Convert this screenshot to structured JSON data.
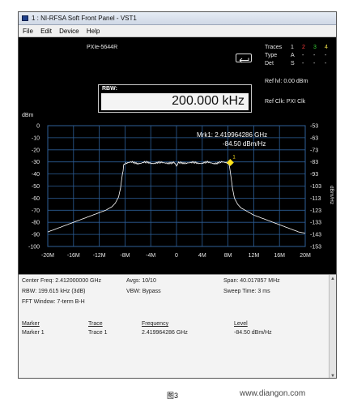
{
  "window": {
    "title": "1 : NI-RFSA Soft Front Panel - VST1",
    "menus": [
      "File",
      "Edit",
      "Device",
      "Help"
    ]
  },
  "header": {
    "device": "PXIe-5644R",
    "traces_label": "Traces",
    "type_label": "Type",
    "det_label": "Det",
    "trace_numbers": [
      "1",
      "2",
      "3",
      "4"
    ],
    "trace_colors": [
      "#ffffff",
      "#ff3b3b",
      "#36d236",
      "#f0e14a"
    ],
    "type_values": [
      "A",
      "-",
      "-",
      "-"
    ],
    "det_values": [
      "S",
      "-",
      "-",
      "-"
    ],
    "ref_lvl": "Ref lvl: 0.00 dBm",
    "ref_clk": "Ref Clk: PXI Clk",
    "rbw_label": "RBW:",
    "rbw_value": "200.000 kHz",
    "return_icon": "return-arrow-icon"
  },
  "chart_data": {
    "type": "line",
    "left_axis_unit": "dBm",
    "right_axis_unit": "dBm/Hz",
    "x_ticks": [
      "-20M",
      "-16M",
      "-12M",
      "-8M",
      "-4M",
      "0",
      "4M",
      "8M",
      "12M",
      "16M",
      "20M"
    ],
    "y_ticks_left": [
      "0",
      "-10",
      "-20",
      "-30",
      "-40",
      "-50",
      "-60",
      "-70",
      "-80",
      "-90",
      "-100"
    ],
    "y_ticks_right": [
      "-53",
      "-63",
      "-73",
      "-83",
      "-93",
      "-103",
      "-113",
      "-123",
      "-133",
      "-143",
      "-153"
    ],
    "xlim": [
      -20,
      20
    ],
    "ylim": [
      -100,
      0
    ],
    "grid": true,
    "series": [
      {
        "color": "#ffffff",
        "x": [
          -20,
          -19,
          -18,
          -17,
          -16,
          -15,
          -14,
          -13,
          -12,
          -11,
          -10,
          -9.5,
          -9,
          -8.7,
          -8.4,
          -8.2,
          -8,
          -7,
          -6,
          -5,
          -4,
          -3,
          -2,
          -1,
          -0.3,
          0,
          0.3,
          1,
          2,
          3,
          4,
          5,
          6,
          7,
          8,
          8.2,
          8.4,
          8.7,
          9,
          9.5,
          10,
          11,
          12,
          13,
          14,
          15,
          16,
          17,
          18,
          19,
          20
        ],
        "y": [
          -88,
          -86,
          -84,
          -82,
          -80,
          -78,
          -76,
          -74,
          -72,
          -70,
          -67,
          -64,
          -59,
          -52,
          -40,
          -33,
          -31,
          -30.5,
          -31,
          -30.5,
          -31,
          -30.5,
          -31,
          -30.5,
          -31,
          -34,
          -31,
          -30.5,
          -31,
          -30.5,
          -31,
          -30.5,
          -31,
          -30.5,
          -30.5,
          -33,
          -40,
          -52,
          -60,
          -65,
          -68,
          -71,
          -74,
          -76,
          -78,
          -80,
          -82,
          -84,
          -86,
          -88,
          -89
        ]
      }
    ],
    "marker": {
      "name": "Mrk1",
      "x": 8.35,
      "y": -30.5,
      "label_line1": "Mrk1: 2.419964286 GHz",
      "label_line2": "-84.50 dBm/Hz",
      "number": "1",
      "color": "#ffe41c"
    }
  },
  "info": {
    "center_freq": "Center Freq: 2.412000000 GHz",
    "avgs": "Avgs: 10/10",
    "span": "Span: 40.017857 MHz",
    "rbw": "RBW: 199.615 kHz (3dB)",
    "vbw": "VBW: Bypass",
    "sweep_time": "Sweep Time: 3 ms",
    "fft_window": "FFT Window: 7-term B-H",
    "marker_table": {
      "headers": [
        "Marker",
        "Trace",
        "Frequency",
        "Level"
      ],
      "rows": [
        [
          "Marker 1",
          "Trace 1",
          "2.419964286 GHz",
          "-84.50 dBm/Hz"
        ]
      ]
    }
  },
  "caption": "图3",
  "watermark": "www.diangon.com"
}
